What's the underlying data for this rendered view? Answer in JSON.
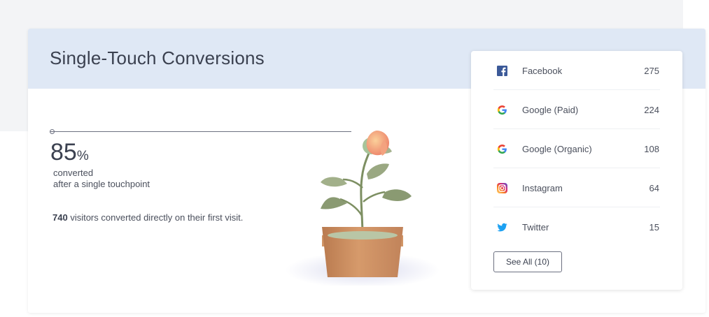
{
  "card": {
    "title": "Single-Touch Conversions"
  },
  "stat": {
    "percent": "85",
    "percent_sign": "%",
    "label_line1": "converted",
    "label_line2": "after a single touchpoint",
    "summary_count": "740",
    "summary_text": " visitors converted directly on their first visit."
  },
  "sources": {
    "items": [
      {
        "name": "Facebook",
        "count": "275",
        "icon": "facebook-icon"
      },
      {
        "name": "Google (Paid)",
        "count": "224",
        "icon": "google-icon"
      },
      {
        "name": "Google (Organic)",
        "count": "108",
        "icon": "google-icon"
      },
      {
        "name": "Instagram",
        "count": "64",
        "icon": "instagram-icon"
      },
      {
        "name": "Twitter",
        "count": "15",
        "icon": "twitter-icon"
      }
    ],
    "see_all_label": "See All (10)"
  },
  "colors": {
    "header_bg": "#dfe8f5",
    "facebook": "#3b5998",
    "twitter": "#1da1f2",
    "pot": "#c98a5c"
  }
}
